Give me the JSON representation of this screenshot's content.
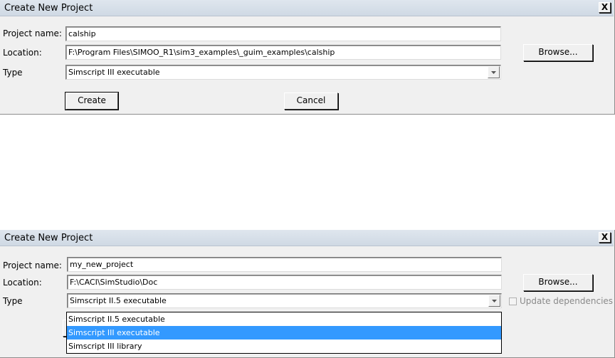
{
  "dialog1": {
    "title": "Create New Project",
    "close_label": "X",
    "project_name_label": "Project name:",
    "project_name_value": "calship",
    "location_label": "Location:",
    "location_value": "F:\\Program Files\\SIMOO_R1\\sim3_examples\\_guim_examples\\calship",
    "browse_label": "Browse...",
    "type_label": "Type",
    "type_value": "Simscript III executable",
    "create_label": "Create",
    "cancel_label": "Cancel"
  },
  "dialog2": {
    "title": "Create New Project",
    "close_label": "X",
    "project_name_label": "Project name:",
    "project_name_value": "my_new_project",
    "location_label": "Location:",
    "location_value": "F:\\CACI\\SimStudio\\Doc",
    "browse_label": "Browse...",
    "type_label": "Type",
    "type_value": "Simscript II.5 executable",
    "update_dependencies_label": "Update dependencies",
    "dropdown_options": [
      "Simscript II.5 executable",
      "Simscript III executable",
      "Simscript III library"
    ],
    "selected_option": "Simscript III executable"
  },
  "colors": {
    "selection": "#3399ff",
    "dialog_bg": "#f0f0f0",
    "titlebar": "#dfe6ee"
  }
}
